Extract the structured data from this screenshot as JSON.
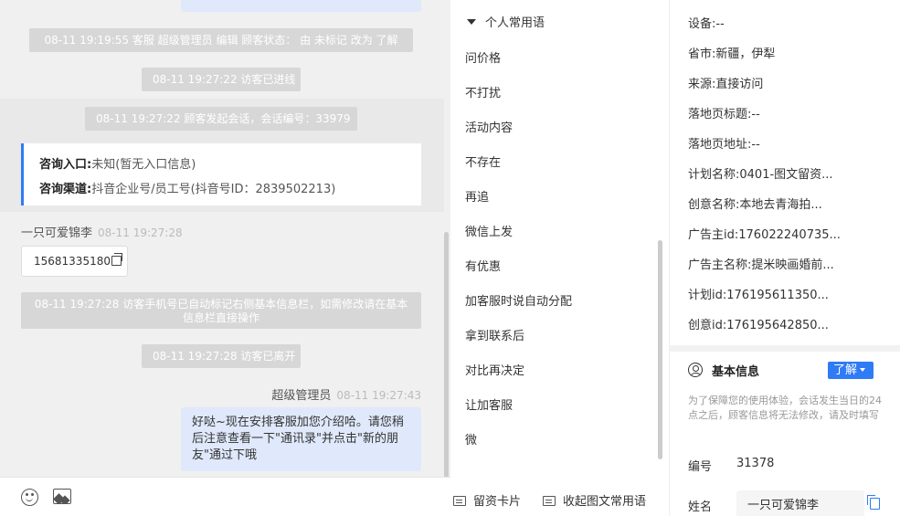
{
  "chat": {
    "sys_msgs": [
      "08-11 19:19:55 客服 超级管理员 编辑 顾客状态： 由 未标记 改为 了解",
      "08-11 19:27:22 访客已进线",
      "08-11 19:27:22 顾客发起会话，会话编号：33979",
      "08-11 19:27:28 访客手机号已自动标记右侧基本信息栏，如需修改请在基本信息栏直接操作",
      "08-11 19:27:28 访客已离开"
    ],
    "entry_label": "咨询入口:",
    "entry_value": "未知(暂无入口信息)",
    "channel_label": "咨询渠道:",
    "channel_value": "抖音企业号/员工号(抖音号ID：2839502213)",
    "visitor_name": "一只可爱锦李",
    "visitor_time": "08-11 19:27:28",
    "visitor_phone": "15681335180",
    "agent_name": "超级管理员",
    "agent_time": "08-11 19:27:43",
    "agent_msg": "好哒~现在安排客服加您介绍哈。请您稍后注意查看一下\"通讯录\"并点击\"新的朋友\"通过下哦"
  },
  "phrases": {
    "header": "个人常用语",
    "items": [
      "问价格",
      "不打扰",
      "活动内容",
      "不存在",
      "再追",
      "微信上发",
      "有优惠",
      "加客服时说自动分配",
      "拿到联系后",
      "对比再决定",
      "让加客服",
      "微"
    ],
    "btn_card": "留资卡片",
    "btn_collect": "收起图文常用语"
  },
  "info": {
    "rows": [
      {
        "label": "设备:",
        "value": "--"
      },
      {
        "label": "省市:",
        "value": "新疆，伊犁"
      },
      {
        "label": "来源:",
        "value": "直接访问"
      },
      {
        "label": "落地页标题:",
        "value": "--"
      },
      {
        "label": "落地页地址:",
        "value": "--"
      },
      {
        "label": "计划名称:",
        "value": "0401-图文留资..."
      },
      {
        "label": "创意名称:",
        "value": "本地去青海拍..."
      },
      {
        "label": "广告主id:",
        "value": "176022240735..."
      },
      {
        "label": "广告主名称:",
        "value": "提米映画婚前..."
      },
      {
        "label": "计划id:",
        "value": "176195611350..."
      },
      {
        "label": "创意id:",
        "value": "176195642850..."
      }
    ],
    "section_title": "基本信息",
    "status_tag": "了解",
    "notice": "为了保障您的使用体验，会话发生当日的24点之后，顾客信息将无法修改，请及时填写",
    "id_label": "编号",
    "id_value": "31378",
    "name_label": "姓名",
    "name_value": "一只可爱锦李"
  },
  "colors": {
    "accent": "#2f7bf6",
    "agent_bubble": "#dfe9fb",
    "system_msg": "#d7d7d7"
  }
}
